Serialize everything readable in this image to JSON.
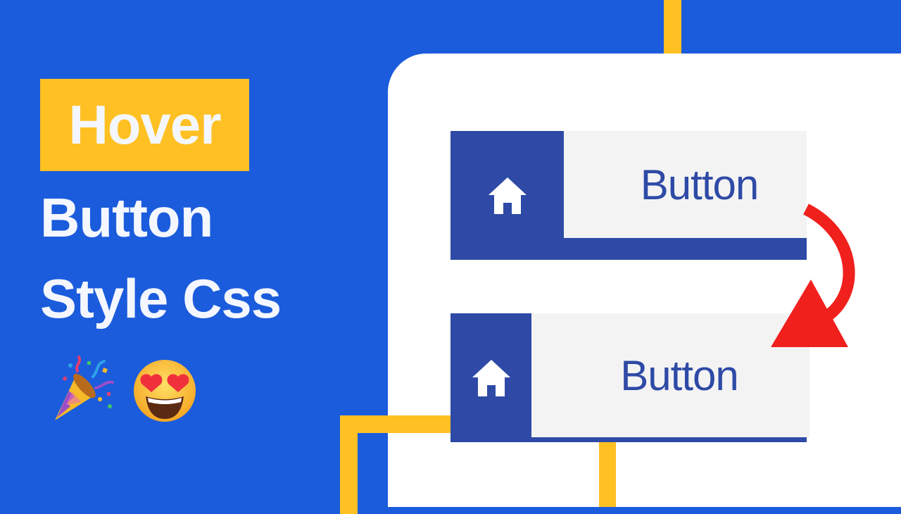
{
  "colors": {
    "background": "#1b5cdc",
    "accent_yellow": "#ffc023",
    "panel": "#ffffff",
    "button_dark": "#2e4aa6",
    "button_light": "#f3f3f3",
    "arrow": "#f0201d"
  },
  "hero": {
    "tag": "Hover",
    "line2": "Button",
    "line3": "Style Css",
    "emojis": [
      "party-popper-icon",
      "heart-eyes-emoji"
    ]
  },
  "demo": {
    "normal_button": {
      "label": "Button",
      "icon": "home-icon"
    },
    "hover_button": {
      "label": "Button",
      "icon": "home-icon"
    },
    "arrow_icon": "curved-arrow-down-icon"
  }
}
